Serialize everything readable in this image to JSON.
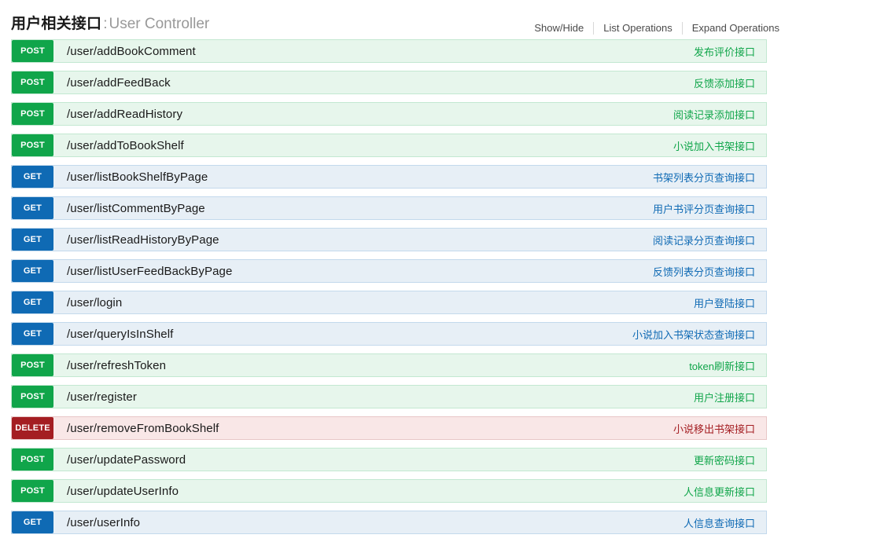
{
  "resource": {
    "title_cn": "用户相关接口",
    "title_separator": ":",
    "title_en": "User Controller",
    "options": {
      "show_hide": "Show/Hide",
      "list_operations": "List Operations",
      "expand_operations": "Expand Operations"
    }
  },
  "colors": {
    "get": "#0f6ab4",
    "post": "#10a54a",
    "delete": "#a41e22",
    "get_row_bg": "#e7eff6",
    "post_row_bg": "#e7f6ec",
    "delete_row_bg": "#f9e7e7"
  },
  "endpoints": [
    {
      "method": "POST",
      "path": "/user/addBookComment",
      "summary": "发布评价接口"
    },
    {
      "method": "POST",
      "path": "/user/addFeedBack",
      "summary": "反馈添加接口"
    },
    {
      "method": "POST",
      "path": "/user/addReadHistory",
      "summary": "阅读记录添加接口"
    },
    {
      "method": "POST",
      "path": "/user/addToBookShelf",
      "summary": "小说加入书架接口"
    },
    {
      "method": "GET",
      "path": "/user/listBookShelfByPage",
      "summary": "书架列表分页查询接口"
    },
    {
      "method": "GET",
      "path": "/user/listCommentByPage",
      "summary": "用户书评分页查询接口"
    },
    {
      "method": "GET",
      "path": "/user/listReadHistoryByPage",
      "summary": "阅读记录分页查询接口"
    },
    {
      "method": "GET",
      "path": "/user/listUserFeedBackByPage",
      "summary": "反馈列表分页查询接口"
    },
    {
      "method": "GET",
      "path": "/user/login",
      "summary": "用户登陆接口"
    },
    {
      "method": "GET",
      "path": "/user/queryIsInShelf",
      "summary": "小说加入书架状态查询接口"
    },
    {
      "method": "POST",
      "path": "/user/refreshToken",
      "summary": "token刷新接口"
    },
    {
      "method": "POST",
      "path": "/user/register",
      "summary": "用户注册接口"
    },
    {
      "method": "DELETE",
      "path": "/user/removeFromBookShelf",
      "summary": "小说移出书架接口"
    },
    {
      "method": "POST",
      "path": "/user/updatePassword",
      "summary": "更新密码接口"
    },
    {
      "method": "POST",
      "path": "/user/updateUserInfo",
      "summary": "人信息更新接口"
    },
    {
      "method": "GET",
      "path": "/user/userInfo",
      "summary": "人信息查询接口"
    }
  ]
}
